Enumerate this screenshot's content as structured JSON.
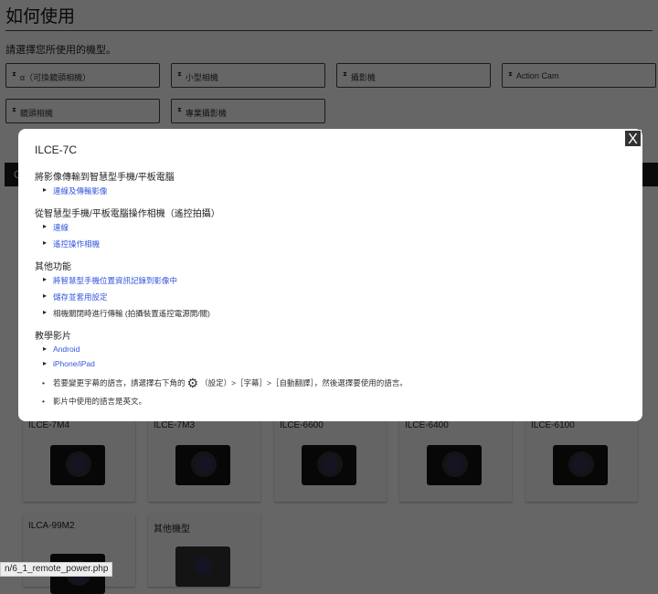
{
  "page": {
    "title": "如何使用",
    "prompt": "請選擇您所使用的機型。",
    "categories": [
      "α（可換鏡頭相機）",
      "小型相機",
      "攝影機",
      "Action Cam",
      "鏡頭相機",
      "專業攝影機"
    ],
    "bar_text": "C",
    "cameras": [
      "ILCE-7M4",
      "ILCE-7M3",
      "ILCE-6600",
      "ILCE-6400",
      "ILCE-6100",
      "ILCA-99M2",
      "其他機型"
    ]
  },
  "modal": {
    "title": "ILCE-7C",
    "close": "X",
    "sections": [
      {
        "heading": "將影像傳輸到智慧型手機/平板電腦",
        "items": [
          "連線及傳輸影像"
        ]
      },
      {
        "heading": "從智慧型手機/平板電腦操作相機（遙控拍攝）",
        "items": [
          "連線",
          "遙控操作相機"
        ]
      },
      {
        "heading": "其他功能",
        "items": [
          "將智慧型手機位置資訊記錄到影像中",
          "儲存並套用設定"
        ],
        "plain": "相機關閉時進行傳輸 (拍攝裝置遙控電源開/關)"
      },
      {
        "heading": "教學影片",
        "items": [
          "Android",
          "iPhone/iPad"
        ]
      }
    ],
    "note1_a": "若要變更字幕的語言，請選擇右下角的",
    "note1_b": "（設定）>［字幕］>［自動翻譯］，然後選擇要使用的語言。",
    "note2": "影片中使用的語言是英文。"
  },
  "status_url": "n/6_1_remote_power.php"
}
